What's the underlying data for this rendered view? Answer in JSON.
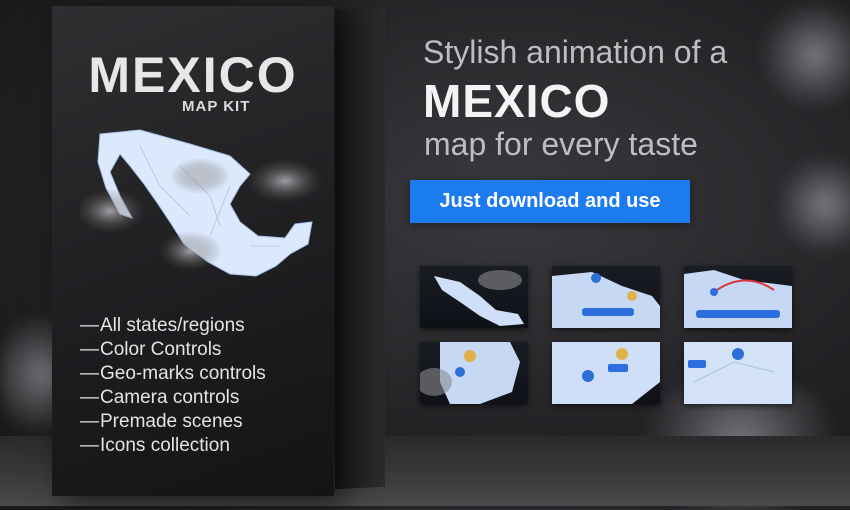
{
  "box": {
    "title": "MEXICO",
    "subtitle": "MAP KIT",
    "features": [
      "All states/regions",
      "Color Controls",
      "Geo-marks controls",
      "Camera controls",
      "Premade scenes",
      "Icons collection"
    ],
    "dash": "—"
  },
  "headline": {
    "line1": "Stylish animation of a",
    "line2": "MEXICO",
    "line3": "map for every taste"
  },
  "cta": {
    "label": "Just download and use",
    "color": "#1d7bf0"
  },
  "thumbnails": [
    {
      "name": "scene-1"
    },
    {
      "name": "scene-2"
    },
    {
      "name": "scene-3"
    },
    {
      "name": "scene-4"
    },
    {
      "name": "scene-5"
    },
    {
      "name": "scene-6"
    }
  ],
  "colors": {
    "background": "#232326",
    "map_fill": "#d9e7fb",
    "accent": "#1d7bf0"
  }
}
